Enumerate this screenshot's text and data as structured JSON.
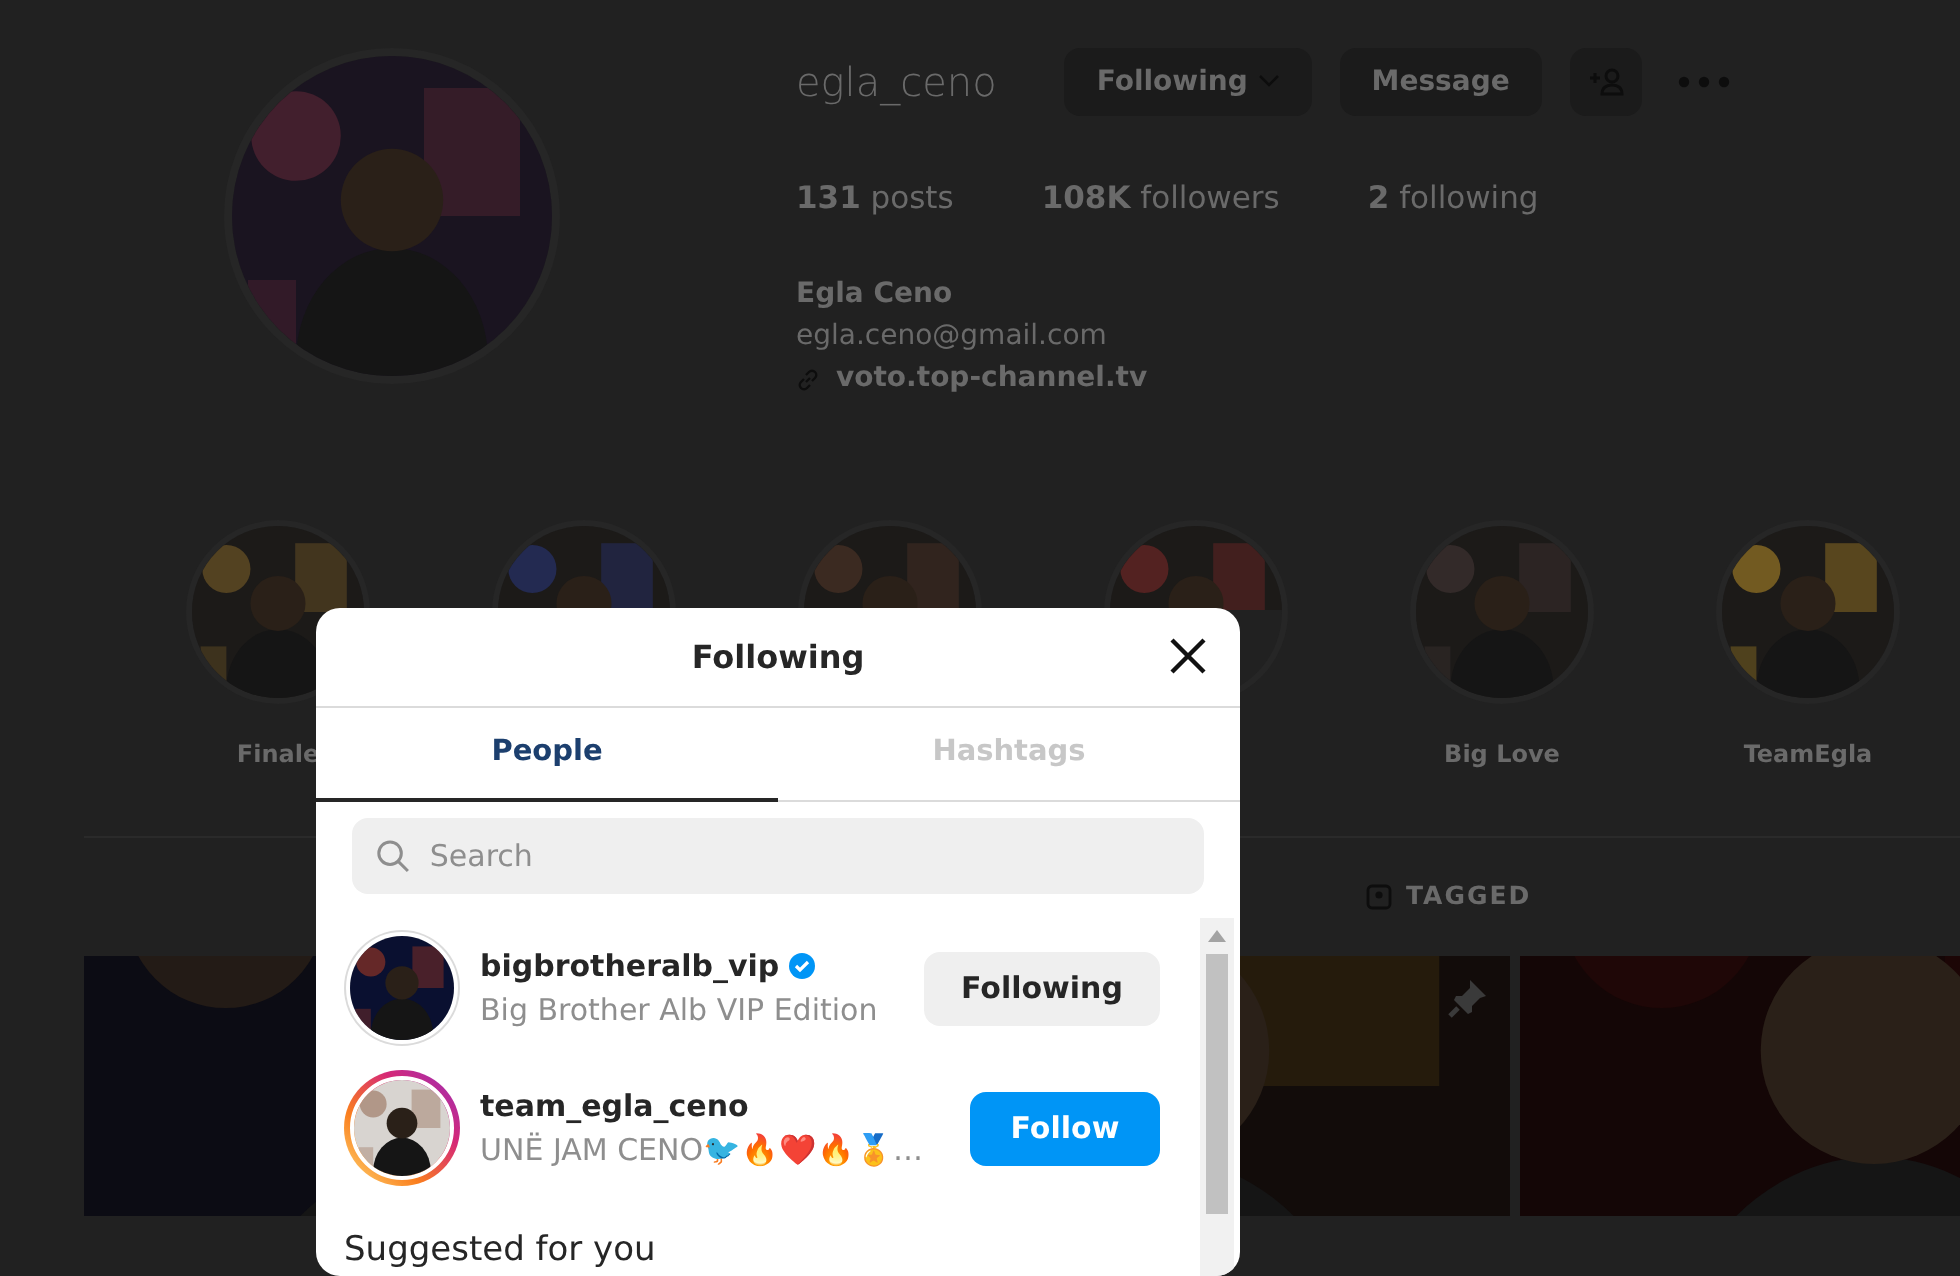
{
  "profile": {
    "username": "egla_ceno",
    "buttons": [
      {
        "label": "Following",
        "kind": "dropdown"
      },
      {
        "label": "Message",
        "kind": "plain"
      },
      {
        "kind": "add-person"
      },
      {
        "kind": "more"
      }
    ],
    "stats": [
      "**131** posts",
      "**108K** followers",
      "**2** following"
    ],
    "name": "Egla Ceno",
    "email": "egla.ceno@gmail.com",
    "link": "voto.top-channel.tv"
  },
  "highlights": [
    {
      "kind": "picture",
      "label": "Finale"
    },
    {
      "kind": "picture"
    },
    {
      "kind": "picture"
    },
    {
      "kind": "picture"
    },
    {
      "kind": "picture",
      "label": "Big Love"
    },
    {
      "kind": "picture",
      "label": "TeamEgla"
    }
  ],
  "profile_tabs": [
    {
      "label": "TAGGED"
    }
  ],
  "posts": [
    {
      "kind": "picture"
    },
    {
      "kind": "picture",
      "pinned": true
    },
    {
      "kind": "picture"
    }
  ],
  "modal": {
    "title": "Following",
    "tabs": [
      {
        "label": "People",
        "selected": true
      },
      {
        "label": "Hashtags",
        "selected": false
      }
    ],
    "search": {
      "placeholder": "Search"
    },
    "accounts": [
      {
        "username": "bigbrotheralb_vip",
        "verified": true,
        "subtitle": "Big Brother Alb VIP Edition",
        "has_story": false,
        "button": "Following",
        "following": true
      },
      {
        "username": "team_egla_ceno",
        "verified": false,
        "subtitle": "UNË JAM CENO🐦🔥❤️🔥🏅…",
        "has_story": true,
        "button": "Follow",
        "following": false
      }
    ],
    "section": "Suggested for you"
  }
}
